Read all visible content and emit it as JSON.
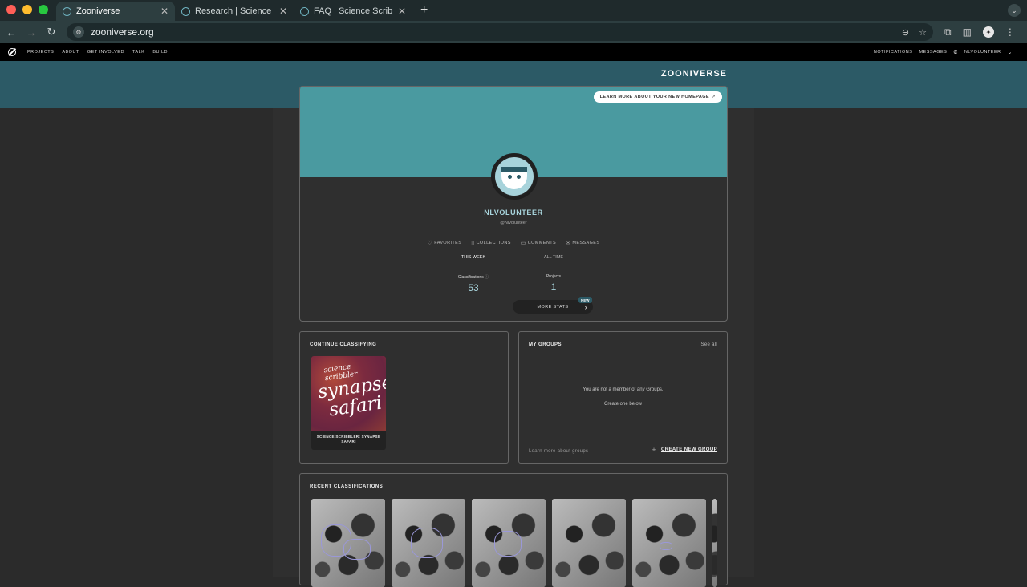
{
  "browser": {
    "traffic_colors": [
      "#ff5f57",
      "#febc2e",
      "#28c840"
    ],
    "tabs": [
      {
        "title": "Zooniverse",
        "active": true
      },
      {
        "title": "Research | Science Scribbler",
        "active": false
      },
      {
        "title": "FAQ | Science Scribbler: Syn",
        "active": false
      }
    ],
    "new_tab": "+",
    "url": "zooniverse.org"
  },
  "sitenav": {
    "left": [
      "PROJECTS",
      "ABOUT",
      "GET INVOLVED",
      "TALK",
      "BUILD"
    ],
    "right": [
      "NOTIFICATIONS",
      "MESSAGES",
      "NLVOLUNTEER"
    ]
  },
  "banner": {
    "brand": "ZOONIVERSE"
  },
  "profile": {
    "learn_more": "LEARN MORE ABOUT YOUR NEW HOMEPAGE",
    "name": "NLVOLUNTEER",
    "handle": "@Nlvolunteer",
    "links": [
      "FAVORITES",
      "COLLECTIONS",
      "COMMENTS",
      "MESSAGES"
    ],
    "tabs": [
      "THIS WEEK",
      "ALL TIME"
    ],
    "stats": [
      {
        "label": "Classifications",
        "value": "53"
      },
      {
        "label": "Projects",
        "value": "1"
      }
    ],
    "more_stats": "MORE STATS",
    "new_badge": "NEW",
    "accent": "#4a9aa0"
  },
  "continue": {
    "title": "CONTINUE CLASSIFYING",
    "project_art": [
      "science scribbler",
      "synapse",
      "safari"
    ],
    "project_name": "SCIENCE SCRIBBLER: SYNAPSE SAFARI"
  },
  "groups": {
    "title": "MY GROUPS",
    "see_all": "See all",
    "empty_1": "You are not a member of any Groups.",
    "empty_2": "Create one below",
    "learn": "Learn more about groups",
    "create": "CREATE NEW GROUP"
  },
  "recent": {
    "title": "RECENT CLASSIFICATIONS"
  }
}
